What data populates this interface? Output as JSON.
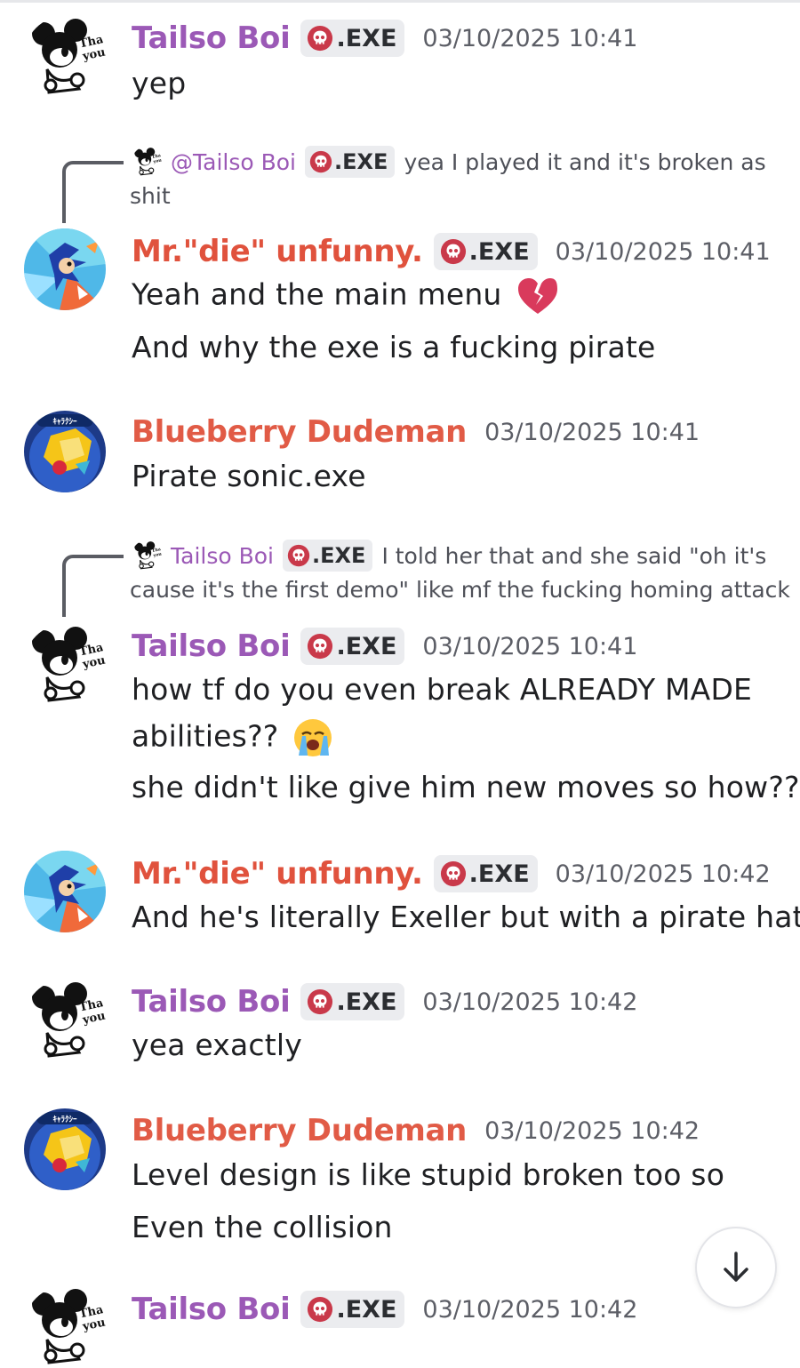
{
  "messages": [
    {
      "user": "Tailso Boi",
      "tag": ".EXE",
      "time": "03/10/2025 10:41",
      "lines": [
        "yep"
      ]
    },
    {
      "reply": {
        "mention": "@Tailso Boi",
        "tag": ".EXE",
        "text1": "yea I played it and it's broken as",
        "text2": "shit"
      },
      "user": "Mr.\"die\" unfunny.",
      "tag": ".EXE",
      "time": "03/10/2025 10:41",
      "lines": [
        "Yeah and the main menu",
        "And why the exe is a fucking pirate"
      ]
    },
    {
      "user": "Blueberry Dudeman",
      "time": "03/10/2025 10:41",
      "lines": [
        "Pirate sonic.exe"
      ]
    },
    {
      "reply": {
        "mention": "Tailso Boi",
        "tag": ".EXE",
        "text1": "I told her that and she said \"oh it's",
        "text2": "cause it's the first demo\" like mf the fucking homing attack"
      },
      "user": "Tailso Boi",
      "tag": ".EXE",
      "time": "03/10/2025 10:41",
      "lines": [
        "how tf do you even break ALREADY MADE",
        "abilities??",
        "she didn't like give him new moves so how??"
      ]
    },
    {
      "user": "Mr.\"die\" unfunny.",
      "tag": ".EXE",
      "time": "03/10/2025 10:42",
      "lines": [
        "And he's literally Exeller but with a pirate hat"
      ]
    },
    {
      "user": "Tailso Boi",
      "tag": ".EXE",
      "time": "03/10/2025 10:42",
      "lines": [
        "yea exactly"
      ]
    },
    {
      "user": "Blueberry Dudeman",
      "time": "03/10/2025 10:42",
      "lines": [
        "Level design is like stupid broken too so",
        "Even the collision"
      ]
    },
    {
      "user": "Tailso Boi",
      "tag": ".EXE",
      "time": "03/10/2025 10:42",
      "lines": []
    }
  ],
  "colors": {
    "tailso": "#9b59b6",
    "mr_die": "#e0523d",
    "blueberry": "#e15b46",
    "tag_bg": "#ebecef"
  },
  "icons": {
    "role": "skull-icon",
    "scroll": "arrow-down-icon",
    "broken_heart": "broken-heart-emoji",
    "crying": "loudly-crying-face-emoji"
  }
}
